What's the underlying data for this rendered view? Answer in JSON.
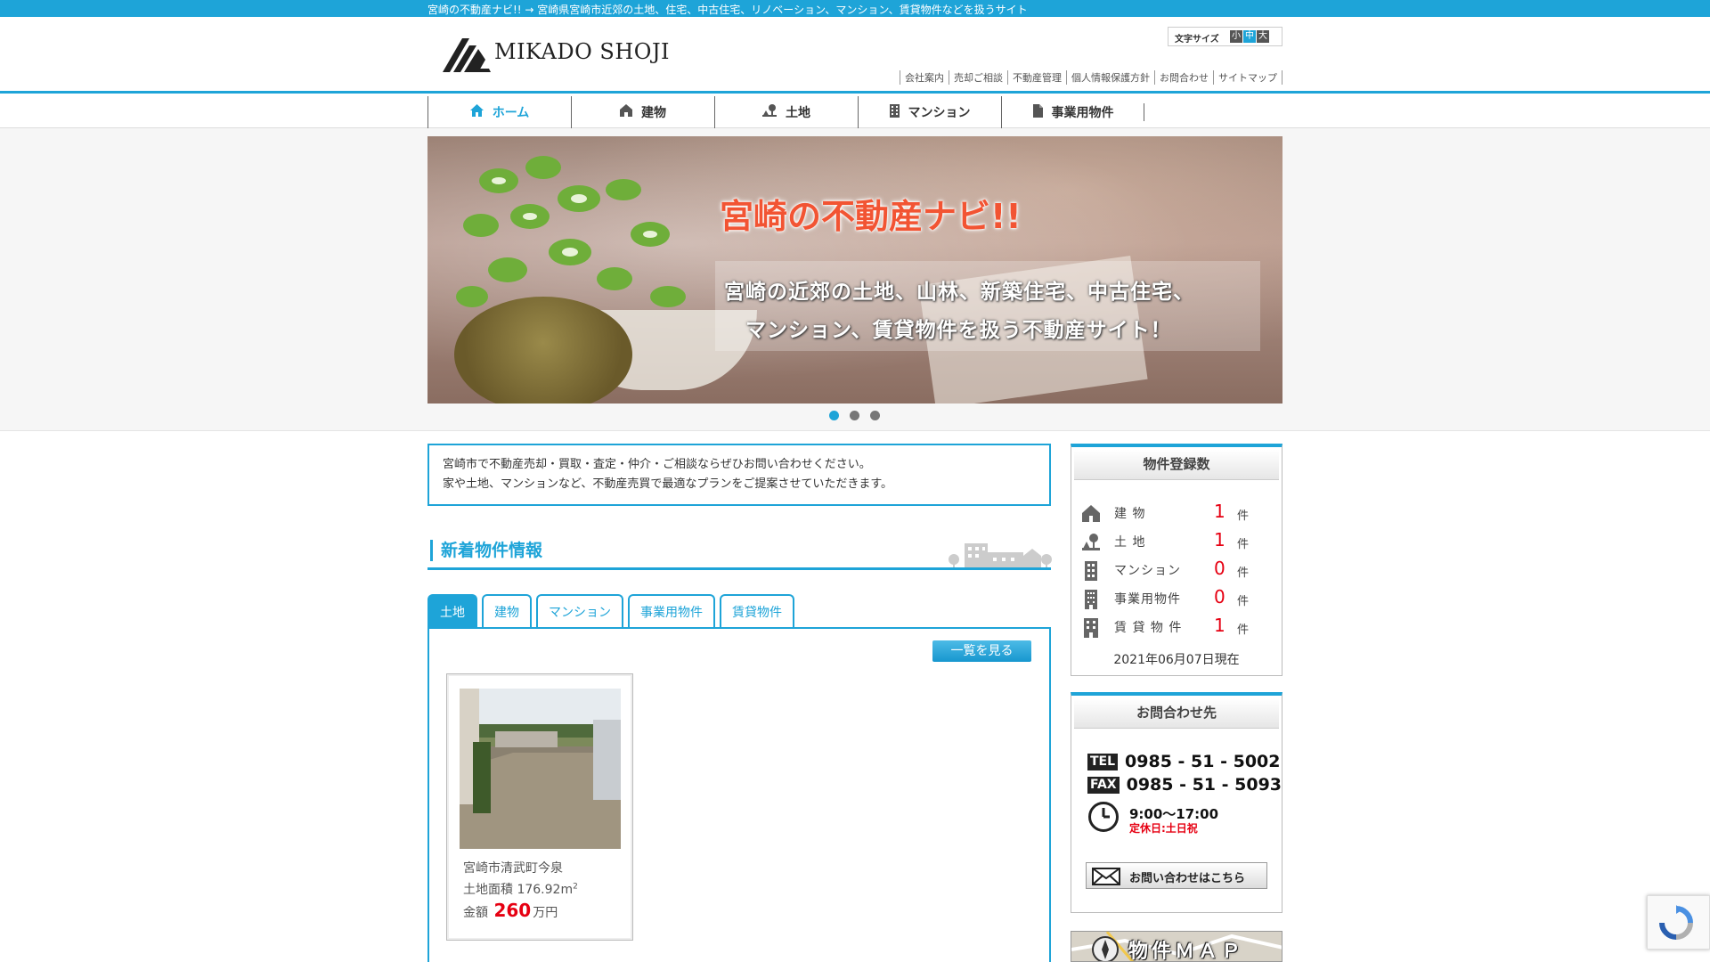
{
  "topbar": {
    "text": "宮崎の不動産ナビ!! → 宮崎県宮崎市近郊の土地、住宅、中古住宅、リノベーション、マンション、賃貸物件などを扱うサイト"
  },
  "header": {
    "logo_text": "MIKADO SHOJI",
    "font_size": {
      "label": "文字サイズ",
      "small": "小",
      "medium": "中",
      "large": "大"
    },
    "util_nav": [
      "会社案内",
      "売却ご相談",
      "不動産管理",
      "個人情報保護方針",
      "お問合わせ",
      "サイトマップ"
    ]
  },
  "gnav": [
    {
      "label": "ホーム",
      "icon": "home-icon"
    },
    {
      "label": "建物",
      "icon": "house-icon"
    },
    {
      "label": "土地",
      "icon": "land-icon"
    },
    {
      "label": "マンション",
      "icon": "building-icon"
    },
    {
      "label": "事業用物件",
      "icon": "document-icon"
    }
  ],
  "slider": {
    "title": "宮崎の不動産ナビ!!",
    "line1": "宮崎の近郊の土地、山林、新築住宅、中古住宅、",
    "line2": "マンション、賃貸物件を扱う不動産サイト！",
    "dots": 3,
    "active_dot": 0
  },
  "intro": {
    "line1": "宮崎市で不動産売却・買取・査定・仲介・ご相談ならぜひお問い合わせください。",
    "line2": "家や土地、マンションなど、不動産売買で最適なプランをご提案させていただきます。"
  },
  "new_listings": {
    "title": "新着物件情報",
    "tabs": [
      "土地",
      "建物",
      "マンション",
      "事業用物件",
      "賃貸物件"
    ],
    "active_tab": 0,
    "list_button": "一覧を見る",
    "card": {
      "address": "宮崎市清武町今泉",
      "area_label": "土地面積",
      "area_value": "176.92m",
      "area_sup": "2",
      "price_label": "金額",
      "price_value": "260",
      "price_unit": "万円"
    }
  },
  "counts": {
    "title": "物件登録数",
    "rows": [
      {
        "label": "建 物",
        "value": "1",
        "unit": "件"
      },
      {
        "label": "土 地",
        "value": "1",
        "unit": "件"
      },
      {
        "label": "マンション",
        "value": "0",
        "unit": "件"
      },
      {
        "label": "事業用物件",
        "value": "0",
        "unit": "件"
      },
      {
        "label": "賃 貸 物 件",
        "value": "1",
        "unit": "件"
      }
    ],
    "as_of": "2021年06月07日現在"
  },
  "contact": {
    "title": "お問合わせ先",
    "tel_label": "TEL",
    "tel": "0985 - 51 - 5002",
    "fax_label": "FAX",
    "fax": "0985 - 51 - 5093",
    "hours": "9:00～17:00",
    "closed": "定休日:土日祝",
    "mail_button": "お問い合わせはこちら"
  },
  "map_banner": {
    "text": "物件ＭＡＰ"
  },
  "colors": {
    "accent": "#1ea4d8",
    "price": "#e60012",
    "title_red": "#f25433"
  }
}
